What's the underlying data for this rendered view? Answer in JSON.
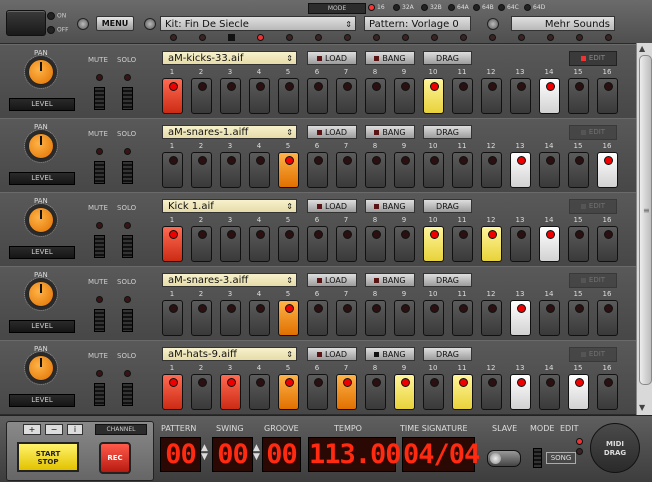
{
  "topbar": {
    "on_label": "ON",
    "off_label": "OFF",
    "menu_label": "MENU",
    "kit_value": "Kit:  Fin De Siecle",
    "pattern_value": "Pattern:  Vorlage 0",
    "more_sounds_label": "Mehr Sounds",
    "mode_label": "MODE",
    "modes": [
      "16",
      "32A",
      "32B",
      "64A",
      "64B",
      "64C",
      "64D"
    ],
    "active_mode": "16",
    "arrows": "⇕"
  },
  "track_labels": {
    "pan": "PAN",
    "mute": "MUTE",
    "solo": "SOLO",
    "level": "LEVEL",
    "load": "LOAD",
    "bang": "BANG",
    "drag": "DRAG",
    "edit": "EDIT"
  },
  "step_numbers": [
    "1",
    "2",
    "3",
    "4",
    "5",
    "6",
    "7",
    "8",
    "9",
    "10",
    "11",
    "12",
    "13",
    "14",
    "15",
    "16"
  ],
  "tracks": [
    {
      "file": "aM-kicks-33.aif",
      "edit_active": true,
      "steps": [
        "red",
        "",
        "",
        "",
        "",
        "",
        "",
        "",
        "",
        "yellow",
        "",
        "",
        "",
        "white",
        "",
        ""
      ]
    },
    {
      "file": "aM-snares-1.aiff",
      "edit_active": false,
      "steps": [
        "",
        "",
        "",
        "",
        "orange",
        "",
        "",
        "",
        "",
        "",
        "",
        "",
        "white",
        "",
        "",
        "white"
      ]
    },
    {
      "file": "Kick 1.aif",
      "edit_active": false,
      "steps": [
        "red",
        "",
        "",
        "",
        "",
        "",
        "",
        "",
        "",
        "yellow",
        "",
        "yellow",
        "",
        "white",
        "",
        ""
      ]
    },
    {
      "file": "aM-snares-3.aiff",
      "edit_active": false,
      "steps": [
        "",
        "",
        "",
        "",
        "orange",
        "",
        "",
        "",
        "",
        "",
        "",
        "",
        "white",
        "",
        "",
        ""
      ]
    },
    {
      "file": "aM-hats-9.aiff",
      "edit_active": false,
      "steps": [
        "red",
        "",
        "red",
        "",
        "orange",
        "",
        "orange",
        "",
        "yellow",
        "",
        "yellow",
        "",
        "white",
        "",
        "white",
        ""
      ]
    }
  ],
  "bottom": {
    "plus": "+",
    "minus": "−",
    "info": "i",
    "channel_label": "CHANNEL",
    "start_stop_label": "START\nSTOP",
    "rec_label": "REC",
    "pattern_label": "PATTERN",
    "pattern_value": "00",
    "swing_label": "SWING",
    "swing_value": "00",
    "groove_label": "GROOVE",
    "groove_value": "00",
    "tempo_label": "TEMPO",
    "tempo_value": "113.00",
    "timesig_label": "TIME SIGNATURE",
    "timesig_value": "04/04",
    "slave_label": "SLAVE",
    "mode_label": "MODE",
    "edit_label": "EDIT",
    "song_label": "SONG",
    "midi_drag_label": "MIDI\nDRAG"
  },
  "colors": {
    "red": "#e8402a",
    "yellow": "#f2e35a",
    "orange": "#f08a1a",
    "white": "#f4f4f4",
    "lcd": "#ff2a10"
  }
}
